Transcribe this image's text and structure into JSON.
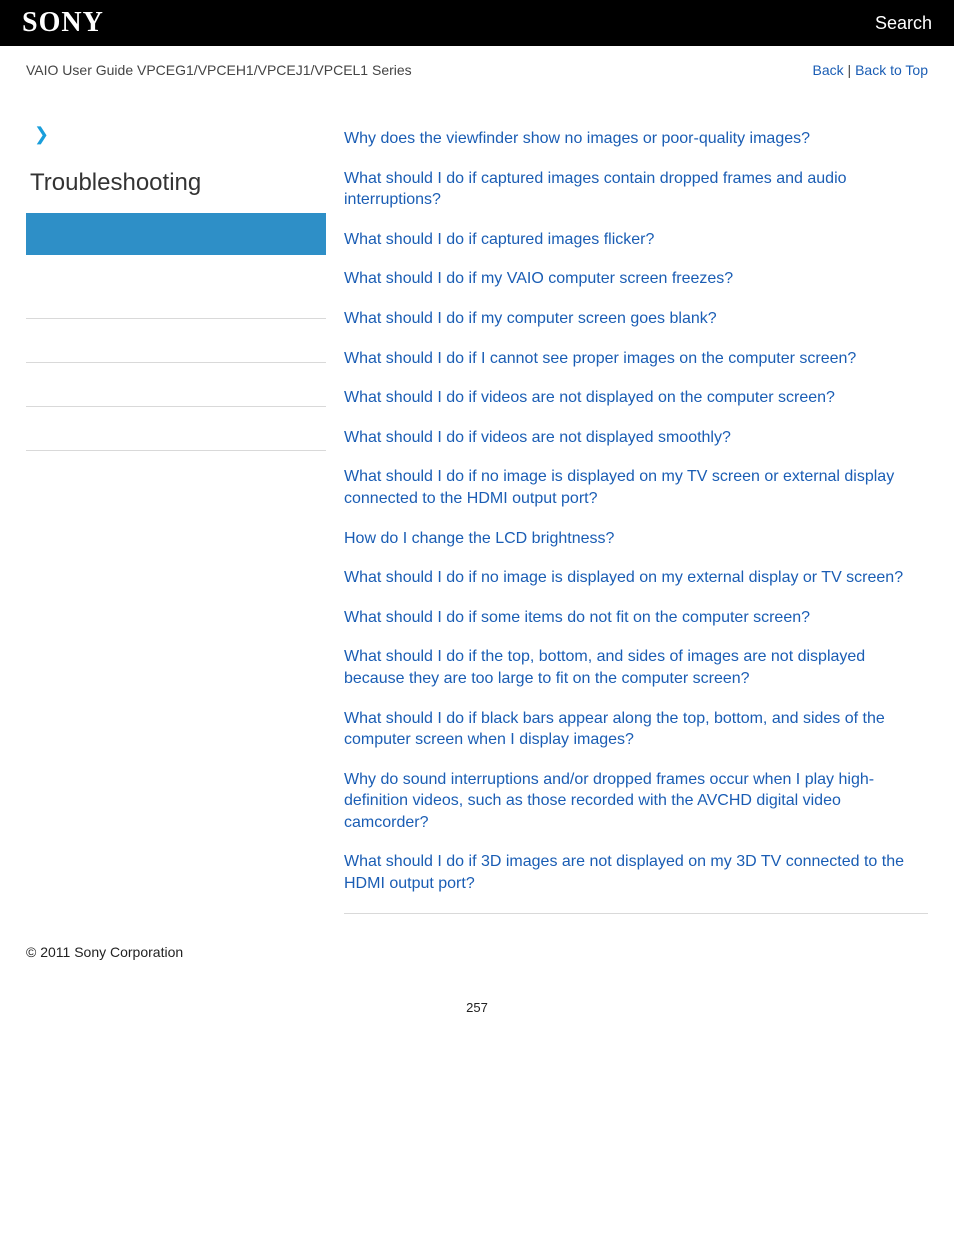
{
  "header": {
    "brand": "SONY",
    "search": "Search"
  },
  "subbar": {
    "guide_title": "VAIO User Guide VPCEG1/VPCEH1/VPCEJ1/VPCEL1 Series",
    "back": "Back",
    "back_to_top": "Back to Top",
    "sep": " | "
  },
  "sidebar": {
    "heading": "Troubleshooting"
  },
  "faq": [
    "Why does the viewfinder show no images or poor-quality images?",
    "What should I do if captured images contain dropped frames and audio interruptions?",
    "What should I do if captured images flicker?",
    "What should I do if my VAIO computer screen freezes?",
    "What should I do if my computer screen goes blank?",
    "What should I do if I cannot see proper images on the computer screen?",
    "What should I do if videos are not displayed on the computer screen?",
    "What should I do if videos are not displayed smoothly?",
    "What should I do if no image is displayed on my TV screen or external display connected to the HDMI output port?",
    "How do I change the LCD brightness?",
    "What should I do if no image is displayed on my external display or TV screen?",
    "What should I do if some items do not fit on the computer screen?",
    "What should I do if the top, bottom, and sides of images are not displayed because they are too large to fit on the computer screen?",
    "What should I do if black bars appear along the top, bottom, and sides of the computer screen when I display images?",
    "Why do sound interruptions and/or dropped frames occur when I play high-definition videos, such as those recorded with the AVCHD digital video camcorder?",
    "What should I do if 3D images are not displayed on my 3D TV connected to the HDMI output port?"
  ],
  "footer": {
    "copyright": "© 2011 Sony Corporation"
  },
  "page_number": "257"
}
